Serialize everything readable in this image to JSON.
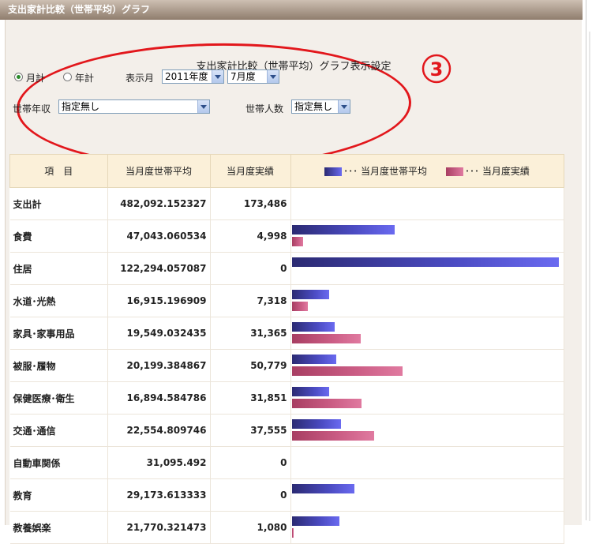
{
  "window": {
    "title": "支出家計比較（世帯平均）グラフ"
  },
  "settings": {
    "title": "支出家計比較（世帯平均）グラフ表示設定",
    "badge": "3",
    "radio_monthly": "月計",
    "radio_yearly": "年計",
    "display_month_label": "表示月",
    "year_value": "2011年度",
    "month_value": "7月度",
    "income_label": "世帯年収",
    "income_value": "指定無し",
    "members_label": "世帯人数",
    "members_value": "指定無し"
  },
  "table": {
    "headers": {
      "item": "項　目",
      "avg": "当月度世帯平均",
      "actual": "当月度実績"
    },
    "legend": {
      "avg": "･･･ 当月度世帯平均",
      "actual": "･･･ 当月度実績"
    },
    "rows": [
      {
        "item": "支出計",
        "avg": "482,092.152327",
        "actual": "173,486",
        "avg_value": 0,
        "actual_value": 0
      },
      {
        "item": "食費",
        "avg": "47,043.060534",
        "actual": "4,998",
        "avg_value": 47043.06,
        "actual_value": 4998
      },
      {
        "item": "住居",
        "avg": "122,294.057087",
        "actual": "0",
        "avg_value": 122294.06,
        "actual_value": 0
      },
      {
        "item": "水道･光熱",
        "avg": "16,915.196909",
        "actual": "7,318",
        "avg_value": 16915.2,
        "actual_value": 7318
      },
      {
        "item": "家具･家事用品",
        "avg": "19,549.032435",
        "actual": "31,365",
        "avg_value": 19549.03,
        "actual_value": 31365
      },
      {
        "item": "被服･履物",
        "avg": "20,199.384867",
        "actual": "50,779",
        "avg_value": 20199.38,
        "actual_value": 50779
      },
      {
        "item": "保健医療･衛生",
        "avg": "16,894.584786",
        "actual": "31,851",
        "avg_value": 16894.58,
        "actual_value": 31851
      },
      {
        "item": "交通･通信",
        "avg": "22,554.809746",
        "actual": "37,555",
        "avg_value": 22554.81,
        "actual_value": 37555
      },
      {
        "item": "自動車関係",
        "avg": "31,095.492",
        "actual": "0",
        "avg_value": 0,
        "actual_value": 0
      },
      {
        "item": "教育",
        "avg": "29,173.613333",
        "actual": "0",
        "avg_value": 28500,
        "actual_value": 0
      },
      {
        "item": "教養娯楽",
        "avg": "21,770.321473",
        "actual": "1,080",
        "avg_value": 21770.32,
        "actual_value": 500
      }
    ]
  },
  "colors": {
    "avg_bar": "#4b4bc2",
    "actual_bar": "#cc5e86",
    "annotation": "#e2171c"
  }
}
